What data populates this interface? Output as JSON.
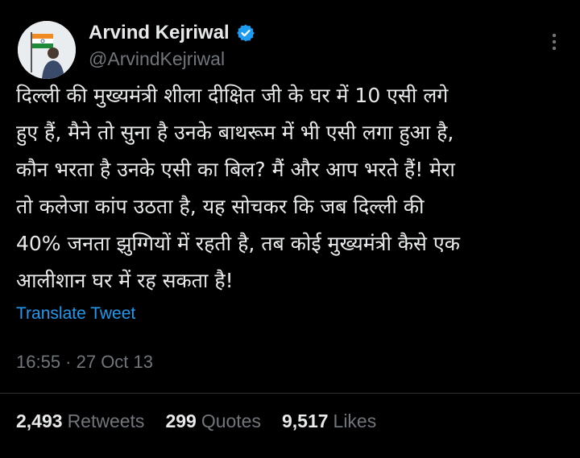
{
  "author": {
    "name": "Arvind Kejriwal",
    "handle": "@ArvindKejriwal",
    "verified": true,
    "verified_color": "#1d9bf0"
  },
  "tweet": {
    "text": "दिल्ली की मुख्यमंत्री शीला दीक्षित जी के घर में 10 एसी लगे\nहुए हैं, मैने तो सुना है उनके बाथरूम में भी एसी लगा हुआ है,\nकौन भरता है उनके एसी का बिल? मैं और आप भरते हैं! मेरा\nतो कलेजा कांप उठता है, यह सोचकर कि जब दिल्ली की\n40% जनता झुग्गियों में रहती है, तब कोई मुख्यमंत्री कैसे एक\nआलीशान घर में रह सकता है!",
    "translate_label": "Translate Tweet",
    "time": "16:55 · 27 Oct 13"
  },
  "stats": {
    "retweets": {
      "count": "2,493",
      "label": "Retweets"
    },
    "quotes": {
      "count": "299",
      "label": "Quotes"
    },
    "likes": {
      "count": "9,517",
      "label": "Likes"
    }
  },
  "icons": {
    "avatar": "profile-photo-with-flag",
    "verified": "verified-badge-icon",
    "more": "more-vertical-icon"
  },
  "colors": {
    "background": "#000000",
    "text": "#e7e9ea",
    "secondary": "#71767b",
    "link": "#1d9bf0",
    "divider": "#2f3336"
  }
}
